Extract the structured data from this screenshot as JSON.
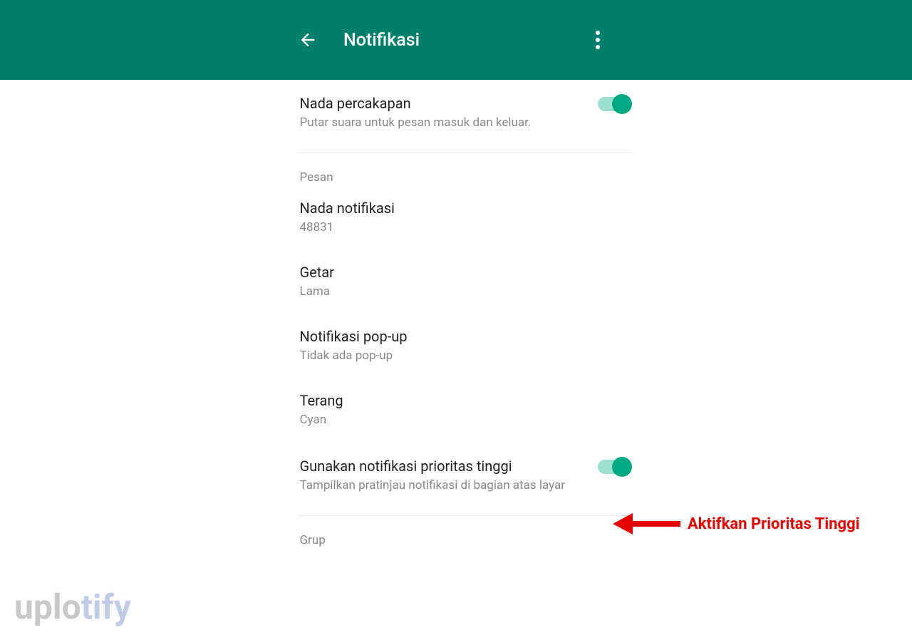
{
  "header": {
    "title": "Notifikasi"
  },
  "settings": {
    "conversationTone": {
      "title": "Nada percakapan",
      "subtitle": "Putar suara untuk pesan masuk dan keluar.",
      "enabled": true
    },
    "sectionMessages": "Pesan",
    "notificationTone": {
      "title": "Nada notifikasi",
      "value": "48831"
    },
    "vibrate": {
      "title": "Getar",
      "value": "Lama"
    },
    "popup": {
      "title": "Notifikasi pop-up",
      "value": "Tidak ada pop-up"
    },
    "light": {
      "title": "Terang",
      "value": "Cyan"
    },
    "highPriority": {
      "title": "Gunakan notifikasi prioritas tinggi",
      "subtitle": "Tampilkan pratinjau notifikasi di bagian atas layar",
      "enabled": true
    },
    "sectionGroup": "Grup"
  },
  "annotation": "Aktifkan Prioritas Tinggi",
  "watermark": {
    "part1": "uplo",
    "part2": "tify"
  }
}
